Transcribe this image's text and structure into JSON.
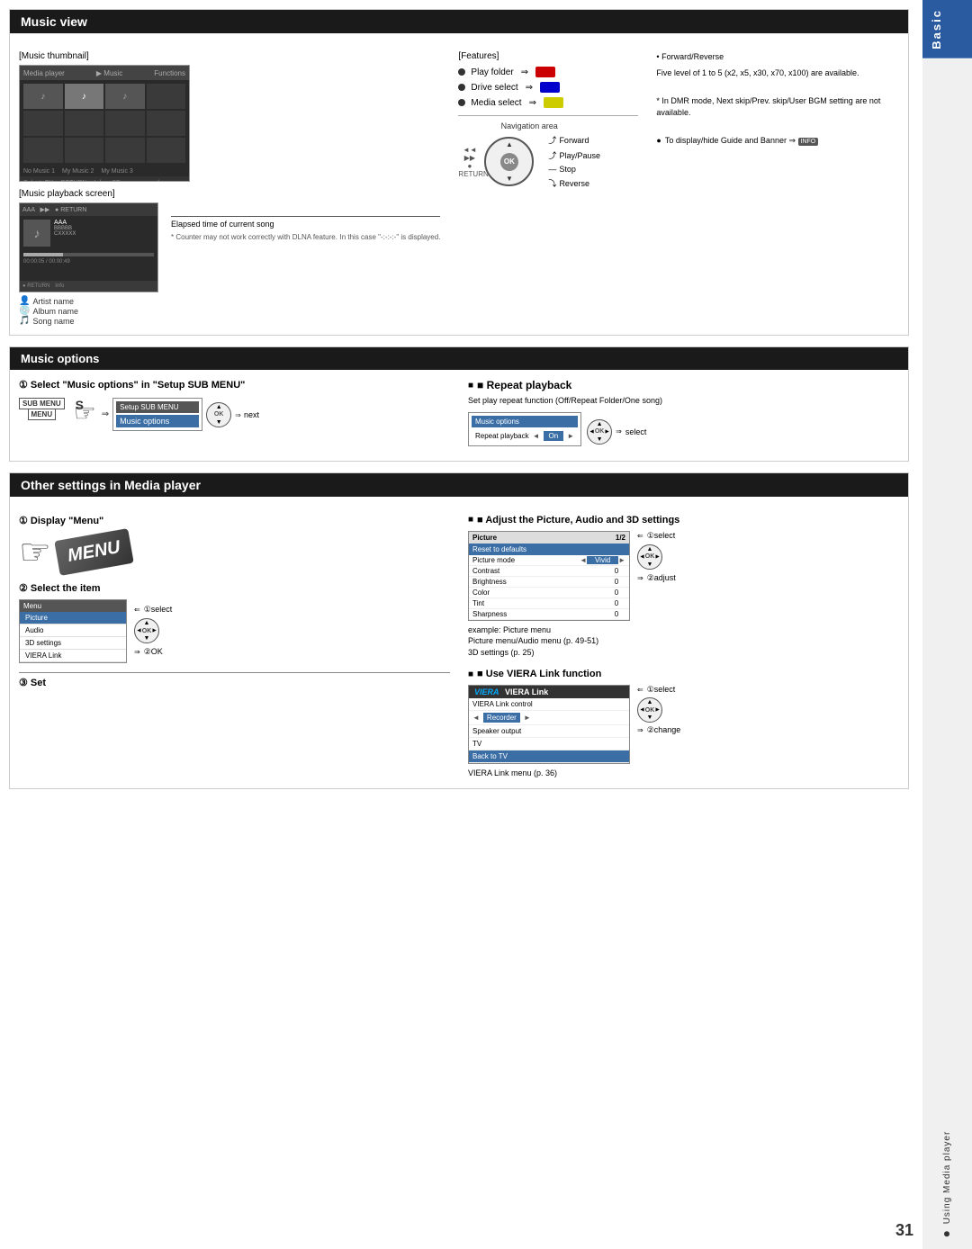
{
  "page": {
    "number": "31"
  },
  "sidebar": {
    "basic_label": "Basic",
    "using_label": "Using Media player"
  },
  "music_view": {
    "title": "Music view",
    "thumbnail_label": "[Music thumbnail]",
    "features_label": "[Features]",
    "playback_screen_label": "[Music playback screen]",
    "navigation_area_label": "Navigation area",
    "features": [
      {
        "text": "Play folder",
        "button_color": "red"
      },
      {
        "text": "Drive select",
        "button_color": "blue"
      },
      {
        "text": "Media select",
        "button_color": "yellow"
      }
    ],
    "nav_labels": [
      "Forward",
      "Play/Pause",
      "Stop",
      "Reverse"
    ],
    "right_notes": [
      "• Forward/Reverse",
      "Five level of 1 to 5 (x2, x5, x30, x70, x100) are available.",
      "* In DMR mode, Next skip/Prev. skip/User BGM setting are not available.",
      "● To display/hide Guide and Banner ⇒"
    ],
    "artist_label": "Artist name",
    "album_label": "Album name",
    "song_label": "Song name",
    "elapsed_label": "Elapsed time of current song",
    "elapsed_note": "* Counter may not work correctly with DLNA feature.",
    "elapsed_note2": "In this case \"-:-:-:-\" is displayed.",
    "pb_title": "AAA",
    "pb_sub1": "BBBBB",
    "pb_sub2": "CXXXXX",
    "pb_time": "00:00:05 / 00:00:49"
  },
  "music_options": {
    "title": "Music options",
    "step1_title": "① Select \"Music options\" in \"Setup SUB MENU\"",
    "sub_menu_title": "Setup SUB MENU",
    "sub_menu_label": "SUB MENU",
    "music_options_item": "Music options",
    "next_label": "next",
    "repeat_title": "■ Repeat playback",
    "repeat_desc": "Set play repeat function (Off/Repeat Folder/One song)",
    "repeat_mockup_title": "Music options",
    "repeat_row_label": "Repeat playback",
    "repeat_arrow_left": "◄",
    "repeat_value": "On",
    "repeat_arrow_right": "►",
    "select_label": "select"
  },
  "other_settings": {
    "title": "Other settings in Media player",
    "step1_title": "① Display \"Menu\"",
    "step2_title": "② Select the item",
    "step3_title": "③ Set",
    "menu_label": "MENU",
    "menu_list_title": "Menu",
    "menu_items": [
      "Picture",
      "Audio",
      "3D settings",
      "VIERA Link"
    ],
    "select_label": "①select",
    "ok_label": "②OK",
    "adjust_title": "■ Adjust the Picture, Audio and 3D settings",
    "picture_title": "Picture",
    "picture_page": "1/2",
    "reset_label": "Reset to defaults",
    "picture_rows": [
      {
        "label": "Picture mode",
        "arrow_l": "◄",
        "value": "Vivid",
        "arrow_r": "►"
      },
      {
        "label": "Contrast",
        "num": "0"
      },
      {
        "label": "Brightness",
        "num": "0"
      },
      {
        "label": "Color",
        "num": "0"
      },
      {
        "label": "Tint",
        "num": "0"
      },
      {
        "label": "Sharpness",
        "num": "0"
      }
    ],
    "example_note": "example: Picture menu",
    "picture_note": "Picture menu/Audio menu (p. 49-51)",
    "settings_3d_note": "3D settings (p. 25)",
    "adj_select_label": "①select",
    "adj_adjust_label": "②adjust",
    "use_viera_title": "■ Use VIERA Link function",
    "viera_title": "VIERA Link",
    "viera_link_title": "VIERA Link control",
    "viera_rows": [
      {
        "label": "◄",
        "value": "Recorder",
        "arrow_r": "►"
      },
      {
        "label": "Speaker output",
        "value": ""
      },
      {
        "label": "TV",
        "value": ""
      }
    ],
    "back_to_tv": "Back to TV",
    "viera_menu_note": "VIERA Link menu (p. 36)",
    "vl_select_label": "①select",
    "vl_change_label": "②change"
  }
}
